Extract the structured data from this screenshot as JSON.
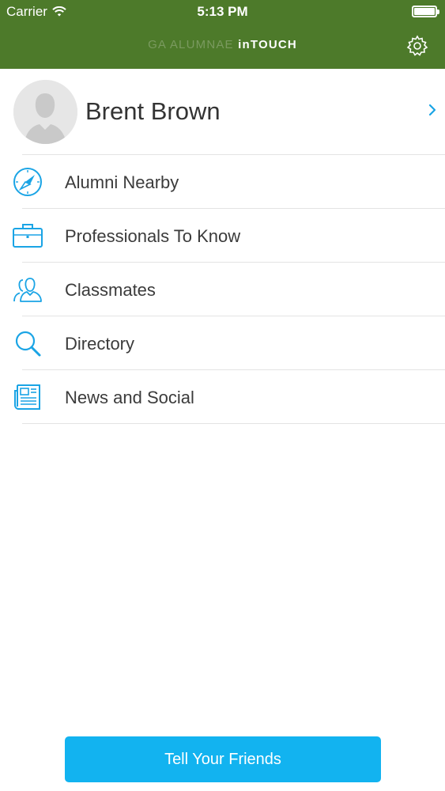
{
  "status_bar": {
    "carrier": "Carrier",
    "time": "5:13 PM"
  },
  "header": {
    "brand_light": "GA ALUMNAE",
    "brand_strong": "inTOUCH",
    "background_color": "#4d7a2a",
    "settings_icon": "gear-icon"
  },
  "profile": {
    "name": "Brent Brown",
    "chevron_icon": "chevron-right-icon"
  },
  "menu": {
    "items": [
      {
        "label": "Alumni Nearby",
        "icon": "compass-icon"
      },
      {
        "label": "Professionals To Know",
        "icon": "briefcase-icon"
      },
      {
        "label": "Classmates",
        "icon": "people-icon"
      },
      {
        "label": "Directory",
        "icon": "search-icon"
      },
      {
        "label": "News and Social",
        "icon": "newspaper-icon"
      }
    ]
  },
  "footer": {
    "cta_label": "Tell Your Friends",
    "accent_color": "#12b3f0"
  }
}
